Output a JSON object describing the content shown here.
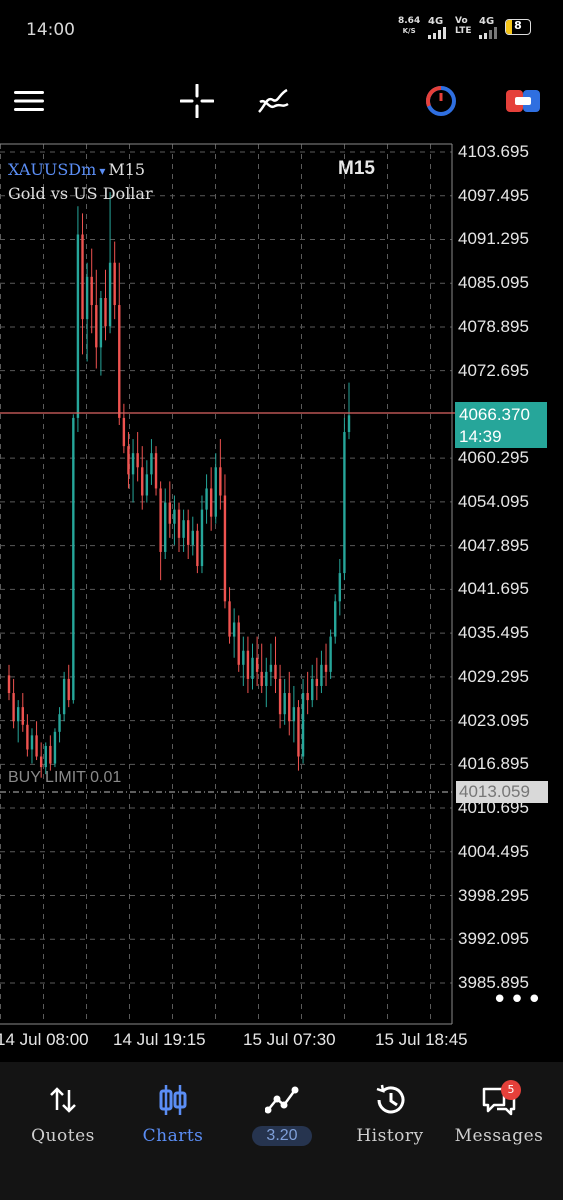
{
  "status_bar": {
    "time": "14:00",
    "net_speed_value": "8.64",
    "net_speed_unit": "K/S",
    "sim1_label": "4G",
    "volte_label": "Vo LTE",
    "sim2_label": "4G",
    "battery_level": "8"
  },
  "toolbar": {
    "menu_icon": "hamburger-icon",
    "crosshair_icon": "crosshair-icon",
    "indicators_icon": "indicators-icon",
    "timeframe": "M15",
    "timer_icon": "timer-icon",
    "trade_icon": "trade-icon"
  },
  "chart": {
    "symbol": "XAUUSDm",
    "symbol_dropdown": "▾",
    "symbol_timeframe": "M15",
    "description": "Gold vs US Dollar",
    "current_price": "4066.370",
    "countdown": "14:39",
    "order_label": "BUY LIMIT 0.01",
    "order_price": "4013.059",
    "more": "•••",
    "up_color": "#26a69a",
    "down_color": "#ef5350"
  },
  "chart_data": {
    "type": "candlestick",
    "symbol": "XAUUSDm",
    "timeframe": "M15",
    "y_ticks": [
      "4103.695",
      "4097.495",
      "4091.295",
      "4085.095",
      "4078.895",
      "4072.695",
      "4066.370",
      "4060.295",
      "4054.095",
      "4047.895",
      "4041.695",
      "4035.495",
      "4029.295",
      "4023.095",
      "4016.895",
      "4010.695",
      "4004.495",
      "3998.295",
      "3992.095",
      "3985.895"
    ],
    "x_ticks": [
      "14 Jul 08:00",
      "14 Jul 19:15",
      "15 Jul 07:30",
      "15 Jul 18:45"
    ],
    "ylim": [
      3981,
      4108
    ],
    "grid": true,
    "current_price": 4066.37,
    "order_line": 4013.059,
    "candles": [
      [
        4029.5,
        4031.0,
        4026.0,
        4027.0
      ],
      [
        4027.0,
        4029.0,
        4022.0,
        4023.0
      ],
      [
        4023.0,
        4026.0,
        4020.0,
        4025.0
      ],
      [
        4025.0,
        4027.0,
        4021.5,
        4022.5
      ],
      [
        4022.5,
        4024.0,
        4018.0,
        4019.0
      ],
      [
        4019.0,
        4022.0,
        4017.0,
        4021.0
      ],
      [
        4021.0,
        4023.0,
        4017.5,
        4018.0
      ],
      [
        4018.0,
        4020.0,
        4015.0,
        4016.5
      ],
      [
        4016.5,
        4020.0,
        4015.5,
        4019.5
      ],
      [
        4019.5,
        4021.0,
        4016.0,
        4017.0
      ],
      [
        4017.0,
        4022.0,
        4016.5,
        4021.5
      ],
      [
        4021.5,
        4025.0,
        4020.0,
        4024.0
      ],
      [
        4024.0,
        4030.0,
        4023.0,
        4029.0
      ],
      [
        4029.0,
        4031.0,
        4025.0,
        4026.0
      ],
      [
        4026.0,
        4066.5,
        4025.5,
        4066.0
      ],
      [
        4066.0,
        4096.0,
        4064.0,
        4092.0
      ],
      [
        4092.0,
        4095.0,
        4075.0,
        4080.0
      ],
      [
        4080.0,
        4088.0,
        4074.0,
        4086.0
      ],
      [
        4086.0,
        4090.0,
        4078.0,
        4082.0
      ],
      [
        4082.0,
        4087.0,
        4073.0,
        4076.0
      ],
      [
        4076.0,
        4084.0,
        4072.0,
        4083.0
      ],
      [
        4083.0,
        4087.0,
        4077.0,
        4079.0
      ],
      [
        4079.0,
        4098.0,
        4078.0,
        4088.0
      ],
      [
        4088.0,
        4091.0,
        4080.0,
        4082.0
      ],
      [
        4082.0,
        4088.0,
        4065.0,
        4066.0
      ],
      [
        4066.0,
        4068.0,
        4061.0,
        4062.0
      ],
      [
        4062.0,
        4064.0,
        4056.0,
        4058.0
      ],
      [
        4058.0,
        4063.0,
        4054.0,
        4061.0
      ],
      [
        4061.0,
        4064.0,
        4057.0,
        4059.0
      ],
      [
        4059.0,
        4062.0,
        4053.0,
        4055.0
      ],
      [
        4055.0,
        4060.0,
        4054.0,
        4058.0
      ],
      [
        4058.0,
        4063.0,
        4056.5,
        4061.0
      ],
      [
        4061.0,
        4062.0,
        4055.0,
        4056.0
      ],
      [
        4056.0,
        4057.0,
        4043.0,
        4047.0
      ],
      [
        4047.0,
        4056.0,
        4046.0,
        4054.0
      ],
      [
        4054.0,
        4057.0,
        4049.0,
        4051.0
      ],
      [
        4051.0,
        4055.0,
        4048.0,
        4053.0
      ],
      [
        4053.0,
        4054.0,
        4047.0,
        4049.0
      ],
      [
        4049.0,
        4053.0,
        4047.0,
        4051.5
      ],
      [
        4051.5,
        4053.0,
        4046.0,
        4048.0
      ],
      [
        4048.0,
        4052.0,
        4046.5,
        4050.0
      ],
      [
        4050.0,
        4051.0,
        4044.0,
        4045.0
      ],
      [
        4045.0,
        4055.0,
        4044.0,
        4053.0
      ],
      [
        4053.0,
        4058.0,
        4051.0,
        4056.0
      ],
      [
        4056.0,
        4059.0,
        4050.0,
        4052.0
      ],
      [
        4052.0,
        4061.0,
        4051.0,
        4059.0
      ],
      [
        4059.0,
        4063.0,
        4053.0,
        4055.0
      ],
      [
        4055.0,
        4058.0,
        4039.0,
        4040.0
      ],
      [
        4040.0,
        4042.0,
        4034.0,
        4035.0
      ],
      [
        4035.0,
        4039.0,
        4032.0,
        4037.0
      ],
      [
        4037.0,
        4038.0,
        4030.0,
        4031.0
      ],
      [
        4031.0,
        4035.0,
        4028.0,
        4033.0
      ],
      [
        4033.0,
        4035.0,
        4027.0,
        4029.0
      ],
      [
        4029.0,
        4034.0,
        4027.5,
        4032.0
      ],
      [
        4032.0,
        4035.0,
        4028.0,
        4030.0
      ],
      [
        4030.0,
        4034.0,
        4027.0,
        4028.0
      ],
      [
        4028.0,
        4032.0,
        4025.0,
        4030.0
      ],
      [
        4030.0,
        4034.0,
        4028.0,
        4031.0
      ],
      [
        4031.0,
        4035.0,
        4027.0,
        4029.0
      ],
      [
        4029.0,
        4031.0,
        4022.0,
        4024.0
      ],
      [
        4024.0,
        4029.0,
        4022.5,
        4027.0
      ],
      [
        4027.0,
        4030.0,
        4021.0,
        4023.0
      ],
      [
        4023.0,
        4028.0,
        4020.0,
        4025.0
      ],
      [
        4025.0,
        4026.0,
        4016.0,
        4018.0
      ],
      [
        4018.0,
        4029.0,
        4017.0,
        4027.0
      ],
      [
        4027.0,
        4030.0,
        4024.0,
        4026.0
      ],
      [
        4026.0,
        4031.0,
        4025.0,
        4029.0
      ],
      [
        4029.0,
        4032.0,
        4026.0,
        4028.0
      ],
      [
        4028.0,
        4033.0,
        4027.0,
        4031.0
      ],
      [
        4031.0,
        4034.0,
        4028.0,
        4030.0
      ],
      [
        4030.0,
        4036.0,
        4029.0,
        4035.0
      ],
      [
        4035.0,
        4041.0,
        4034.0,
        4040.0
      ],
      [
        4040.0,
        4046.0,
        4038.0,
        4044.0
      ],
      [
        4044.0,
        4066.0,
        4043.0,
        4064.0
      ],
      [
        4064.0,
        4071.0,
        4063.0,
        4066.37
      ]
    ]
  },
  "bottom_nav": {
    "items": [
      {
        "label": "Quotes",
        "icon": "quotes-icon"
      },
      {
        "label": "Charts",
        "icon": "charts-icon"
      },
      {
        "label": "3.20",
        "icon": "trade-graph-icon"
      },
      {
        "label": "History",
        "icon": "history-icon"
      },
      {
        "label": "Messages",
        "icon": "messages-icon"
      }
    ],
    "messages_badge": "5"
  }
}
